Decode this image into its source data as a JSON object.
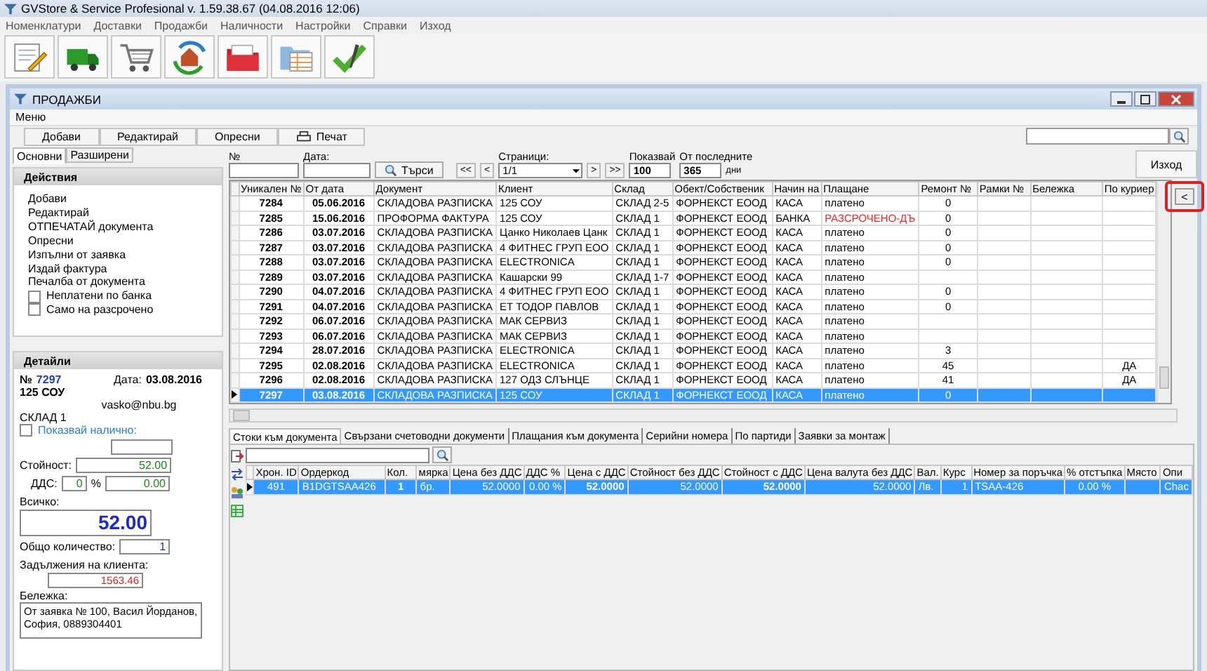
{
  "app": {
    "title": "GVStore & Service Profesional v. 1.59.38.67 (04.08.2016 12:06)",
    "menu": [
      "Номенклатури",
      "Доставки",
      "Продажби",
      "Наличности",
      "Настройки",
      "Справки",
      "Изход"
    ]
  },
  "window": {
    "title": "ПРОДАЖБИ",
    "menu": "Меню",
    "buttons": [
      {
        "label": "Добави",
        "kind": "plain"
      },
      {
        "label": "Редактирай",
        "kind": "plain"
      },
      {
        "label": "Опресни",
        "kind": "plain"
      },
      {
        "label": "Печат",
        "kind": "print"
      }
    ],
    "exit": "Изход",
    "collapse": "<"
  },
  "left_tabs": [
    {
      "label": "Основни",
      "selected": true
    },
    {
      "label": "Разширени",
      "selected": false
    }
  ],
  "actions": {
    "title": "Действия",
    "items": [
      {
        "label": "Добави",
        "kind": "link"
      },
      {
        "label": "Редактирай",
        "kind": "link"
      },
      {
        "label": "ОТПЕЧАТАЙ документа",
        "kind": "link"
      },
      {
        "label": "Опресни",
        "kind": "link"
      },
      {
        "label": "Изпълни от заявка",
        "kind": "link"
      },
      {
        "label": "Издай фактура",
        "kind": "link"
      },
      {
        "label": "Печалба от документа",
        "kind": "link"
      },
      {
        "label": "Неплатени по банка",
        "kind": "checkbox",
        "checked": false
      },
      {
        "label": "Само на разсрочено",
        "kind": "checkbox",
        "checked": false
      }
    ]
  },
  "details": {
    "title": "Детайли",
    "number_label": "№",
    "number": "7297",
    "date_label": "Дата:",
    "date": "03.08.2016",
    "client": "125 СОУ",
    "email": "vasko@nbu.bg",
    "warehouse": "СКЛАД 1",
    "show_stock": {
      "label": "Показвай налично:",
      "checked": false
    },
    "value_label": "Стойност:",
    "value": "52.00",
    "vat_label": "ДДС:",
    "vat_percent": "0",
    "percent_sign": "%",
    "vat": "0.00",
    "total_label": "Всичко:",
    "total": "52.00",
    "quantity_label": "Общо количество:",
    "quantity": "1",
    "debt_label": "Задължения на клиента:",
    "debt": "1563.46",
    "note_label": "Бележка:",
    "note": "От заявка № 100, Васил Йорданов, София, 0889304401"
  },
  "filters": {
    "number_label": "№",
    "date_label": "Дата:",
    "search_button": "Търси",
    "first": "<<",
    "prev": "<",
    "pages_label": "Страници:",
    "page": "1/1",
    "next": ">",
    "last": ">>",
    "show_label": "Показвай",
    "show": "100",
    "period_label": "От последните",
    "days": "365",
    "days_unit": "дни"
  },
  "table": {
    "columns": [
      "Уникален №",
      "От дата",
      "Документ",
      "Клиент",
      "Склад",
      "Обект/Собственик",
      "Начин на",
      "Плащане",
      "Ремонт №",
      "Рамки №",
      "Бележка",
      "По куриер"
    ],
    "rows": [
      {
        "cells": [
          "7284",
          "05.06.2016",
          "СКЛАДОВА РАЗПИСКА",
          "125 СОУ",
          "СКЛАД 2-5",
          "ФОРНЕКСТ ЕООД",
          "КАСА",
          "платено",
          "0",
          null,
          null,
          null
        ],
        "selected": false,
        "alert": false
      },
      {
        "cells": [
          "7285",
          "15.06.2016",
          "ПРОФОРМА ФАКТУРА",
          "125 СОУ",
          "СКЛАД 1",
          "ФОРНЕКСТ ЕООД",
          "БАНКА",
          "РАЗСРОЧЕНО-ДЪ",
          "0",
          null,
          null,
          null
        ],
        "selected": false,
        "alert": true
      },
      {
        "cells": [
          "7286",
          "03.07.2016",
          "СКЛАДОВА РАЗПИСКА",
          "Цанко Николаев Цанк",
          "СКЛАД 1",
          "ФОРНЕКСТ ЕООД",
          "КАСА",
          "платено",
          "0",
          null,
          null,
          null
        ],
        "selected": false,
        "alert": false
      },
      {
        "cells": [
          "7287",
          "03.07.2016",
          "СКЛАДОВА РАЗПИСКА",
          "4 ФИТНЕС ГРУП ЕОО",
          "СКЛАД 1",
          "ФОРНЕКСТ ЕООД",
          "КАСА",
          "платено",
          "0",
          null,
          null,
          null
        ],
        "selected": false,
        "alert": false
      },
      {
        "cells": [
          "7288",
          "03.07.2016",
          "СКЛАДОВА РАЗПИСКА",
          "ELECTRONICA",
          "СКЛАД 1",
          "ФОРНЕКСТ ЕООД",
          "КАСА",
          "платено",
          "0",
          null,
          null,
          null
        ],
        "selected": false,
        "alert": false
      },
      {
        "cells": [
          "7289",
          "03.07.2016",
          "СКЛАДОВА РАЗПИСКА",
          "Кашарски 99",
          "СКЛАД 1-7",
          "ФОРНЕКСТ ЕООД",
          "КАСА",
          "платено",
          null,
          null,
          null,
          null
        ],
        "selected": false,
        "alert": false
      },
      {
        "cells": [
          "7290",
          "04.07.2016",
          "СКЛАДОВА РАЗПИСКА",
          "4 ФИТНЕС ГРУП ЕОО",
          "СКЛАД 1",
          "ФОРНЕКСТ ЕООД",
          "КАСА",
          "платено",
          "0",
          null,
          null,
          null
        ],
        "selected": false,
        "alert": false
      },
      {
        "cells": [
          "7291",
          "04.07.2016",
          "СКЛАДОВА РАЗПИСКА",
          "ЕТ ТОДОР ПАВЛОВ",
          "СКЛАД 1",
          "ФОРНЕКСТ ЕООД",
          "КАСА",
          "платено",
          "0",
          null,
          null,
          null
        ],
        "selected": false,
        "alert": false
      },
      {
        "cells": [
          "7292",
          "06.07.2016",
          "СКЛАДОВА РАЗПИСКА",
          "МАК СЕРВИЗ",
          "СКЛАД 1",
          "ФОРНЕКСТ ЕООД",
          "КАСА",
          "платено",
          null,
          null,
          null,
          null
        ],
        "selected": false,
        "alert": false
      },
      {
        "cells": [
          "7293",
          "06.07.2016",
          "СКЛАДОВА РАЗПИСКА",
          "МАК СЕРВИЗ",
          "СКЛАД 1",
          "ФОРНЕКСТ ЕООД",
          "КАСА",
          "платено",
          null,
          null,
          null,
          null
        ],
        "selected": false,
        "alert": false
      },
      {
        "cells": [
          "7294",
          "28.07.2016",
          "СКЛАДОВА РАЗПИСКА",
          "ELECTRONICA",
          "СКЛАД 1",
          "ФОРНЕКСТ ЕООД",
          "КАСА",
          "платено",
          "3",
          null,
          null,
          null
        ],
        "selected": false,
        "alert": false
      },
      {
        "cells": [
          "7295",
          "02.08.2016",
          "СКЛАДОВА РАЗПИСКА",
          "ELECTRONICA",
          "СКЛАД 1",
          "ФОРНЕКСТ ЕООД",
          "КАСА",
          "платено",
          "45",
          null,
          null,
          "ДА"
        ],
        "selected": false,
        "alert": false
      },
      {
        "cells": [
          "7296",
          "02.08.2016",
          "СКЛАДОВА РАЗПИСКА",
          "127 ОДЗ СЛЪНЦЕ",
          "СКЛАД 1",
          "ФОРНЕКСТ ЕООД",
          "КАСА",
          "платено",
          "41",
          null,
          null,
          "ДА"
        ],
        "selected": false,
        "alert": false
      },
      {
        "cells": [
          "7297",
          "03.08.2016",
          "СКЛАДОВА РАЗПИСКА",
          "125 СОУ",
          "СКЛАД 1",
          "ФОРНЕКСТ ЕООД",
          "КАСА",
          "платено",
          "0",
          null,
          null,
          null
        ],
        "selected": true,
        "alert": false
      }
    ]
  },
  "bottom_tabs": [
    {
      "label": "Стоки към документа",
      "selected": true
    },
    {
      "label": "Свързани счетоводни документи",
      "selected": false
    },
    {
      "label": "Плащания към документа",
      "selected": false
    },
    {
      "label": "Серийни номера",
      "selected": false
    },
    {
      "label": "По партиди",
      "selected": false
    },
    {
      "label": "Заявки за монтаж",
      "selected": false
    }
  ],
  "items": {
    "columns": [
      "Хрон. ID",
      "Ордеркод",
      "Кол.",
      "мярка",
      "Цена без ДДС",
      "ДДС %",
      "Цена с ДДС",
      "Стойност без ДДС",
      "Стойност с ДДС",
      "Цена валута без ДДС",
      "Вал.",
      "Курс",
      "Номер за поръчка",
      "% отстъпка",
      "Място",
      "Опи"
    ],
    "rows": [
      {
        "cells": [
          "491",
          "B1DGTSAA426",
          "1",
          "бр.",
          "52.0000",
          "0.00 %",
          "52.0000",
          "52.0000",
          "52.0000",
          "52.0000",
          "Лв.",
          "1",
          "TSAA-426",
          "0.00 %",
          null,
          "Chac"
        ],
        "selected": true
      }
    ]
  }
}
